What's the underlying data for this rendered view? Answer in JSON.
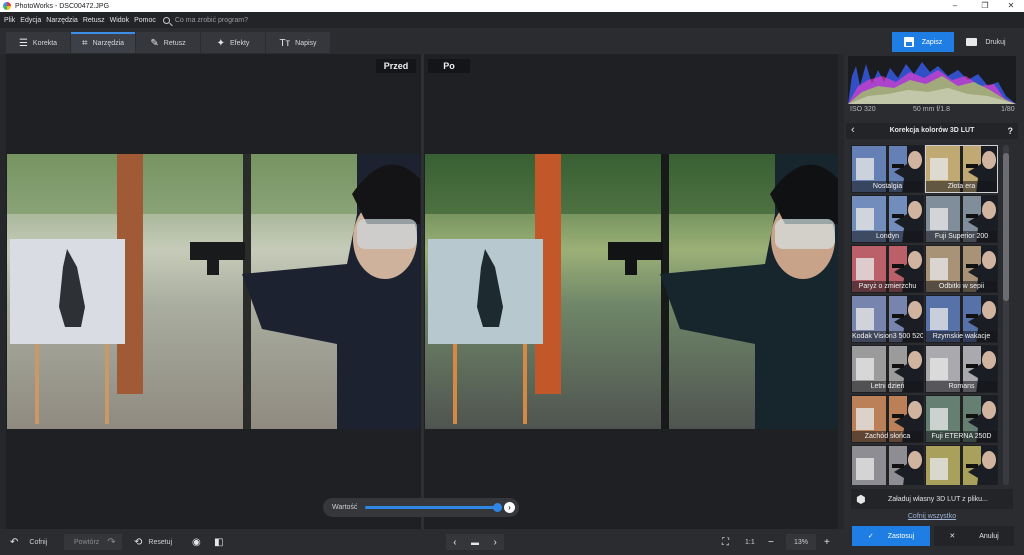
{
  "app": {
    "title": "PhotoWorks - DSC00472.JPG",
    "colors": {
      "accent": "#1e7ee4",
      "bg": "#26272b"
    }
  },
  "window_controls": {
    "minimize": "–",
    "maximize": "❐",
    "close": "✕"
  },
  "menu": {
    "items": [
      "Plik",
      "Edycja",
      "Narzędzia",
      "Retusz",
      "Widok",
      "Pomoc"
    ],
    "search_placeholder": "Co ma zrobić program?",
    "search_icon": "search-icon"
  },
  "toolbar": {
    "tabs": [
      {
        "label": "Korekta",
        "icon": "sliders-icon",
        "glyph": "☰",
        "active": false
      },
      {
        "label": "Narzędzia",
        "icon": "crop-icon",
        "glyph": "⌗",
        "active": true
      },
      {
        "label": "Retusz",
        "icon": "brush-icon",
        "glyph": "✎",
        "active": false
      },
      {
        "label": "Efekty",
        "icon": "magic-wand-icon",
        "glyph": "✦",
        "active": false
      },
      {
        "label": "Napisy",
        "icon": "text-icon",
        "glyph": "Tт",
        "active": false
      }
    ],
    "save_label": "Zapisz",
    "print_label": "Drukuj"
  },
  "viewer": {
    "before_label": "Przed",
    "after_label": "Po"
  },
  "slider": {
    "label": "Wartość",
    "value": 1.0
  },
  "bottom": {
    "undo_label": "Cofnij",
    "undo_glyph": "↶",
    "redo_label": "Powtórz",
    "redo_glyph": "↷",
    "reset_label": "Resetuj",
    "reset_glyph": "⟲",
    "eye_glyph": "◉",
    "compare_glyph": "◧",
    "prev_glyph": "‹",
    "folder_glyph": "▬",
    "next_glyph": "›",
    "fit_glyph": "⛶",
    "ratio_label": "1:1",
    "zoom_out_glyph": "−",
    "zoom_label": "13%",
    "zoom_in_glyph": "+"
  },
  "histogram": {
    "iso": "ISO 320",
    "lens": "50 mm f/1.8",
    "shutter": "1/80"
  },
  "lut_panel": {
    "back_glyph": "‹",
    "title": "Korekcja kolorów 3D LUT",
    "help_glyph": "?",
    "presets": [
      "Nostalgia",
      "Złota era",
      "Londyn",
      "Fuji Superior 200",
      "Paryż o zmierzchu",
      "Odbitki w sepii",
      "Kodak Vision3 500 5203",
      "Rzymskie wakacje",
      "Letni dzień",
      "Romans",
      "Zachód słońca",
      "Fuji ETERNA 250D",
      "",
      ""
    ],
    "selected_index": 1,
    "load_label": "Załaduj własny 3D LUT z pliku...",
    "undo_all_label": "Cofnij wszystko",
    "apply_label": "Zastosuj",
    "apply_glyph": "✓",
    "cancel_label": "Anuluj",
    "cancel_glyph": "✕"
  }
}
